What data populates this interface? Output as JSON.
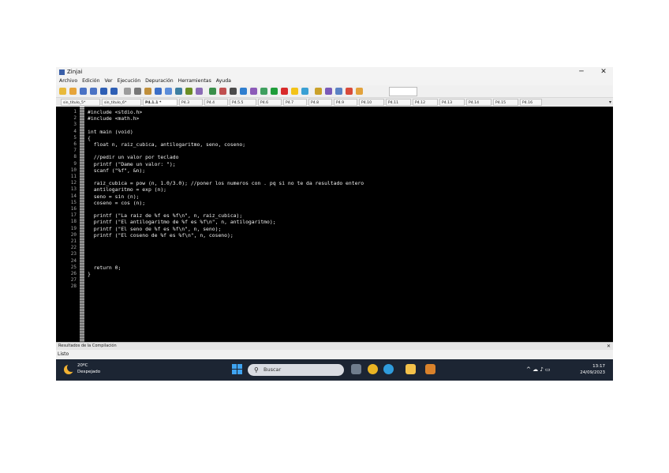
{
  "window": {
    "title": "Zinjai",
    "minimize": "─",
    "close": "✕"
  },
  "menu": [
    "Archivo",
    "Edición",
    "Ver",
    "Ejecución",
    "Depuración",
    "Herramientas",
    "Ayuda"
  ],
  "toolbar": {
    "icons": [
      "new-file-icon",
      "open-folder-icon",
      "save-icon",
      "save-all-icon",
      "undo-icon",
      "redo-icon",
      "cut-icon",
      "copy-icon",
      "paste-icon",
      "find-icon",
      "find-replace-icon",
      "goto-icon",
      "toggle-comment-icon",
      "indent-icon",
      "compile-icon",
      "build-icon",
      "settings-icon",
      "help-icon",
      "info-icon",
      "debug-icon",
      "run-icon",
      "stop-icon",
      "breakpoint-icon",
      "watch-icon",
      "inspect-icon",
      "step-icon",
      "project-icon",
      "flag-icon",
      "bug-icon"
    ],
    "colors": [
      "#e8b93b",
      "#e6a43a",
      "#4a72c4",
      "#4a72c4",
      "#2e5fb5",
      "#2e5fb5",
      "#9c9c9c",
      "#777777",
      "#c08f3b",
      "#3c6fc7",
      "#5c8dd9",
      "#3d7ea0",
      "#6b8e23",
      "#8a6bb5",
      "#3a8f4a",
      "#c05050",
      "#4b4b4b",
      "#2f7ecf",
      "#8c5ab8",
      "#3f9f5f",
      "#1f9d3a",
      "#d82a2a",
      "#f3c318",
      "#3aa0d4",
      "#caa12a",
      "#7a5ab8",
      "#5a82c4",
      "#d84a3a",
      "#e2a23c"
    ]
  },
  "tabs": [
    {
      "label": "sin_titulo_5*"
    },
    {
      "label": "sin_titulo_6*"
    },
    {
      "label": "P4.1.1 *"
    },
    {
      "label": "P4.3"
    },
    {
      "label": "P4.4"
    },
    {
      "label": "P4.5.5"
    },
    {
      "label": "P4.6"
    },
    {
      "label": "P4.7"
    },
    {
      "label": "P4.8"
    },
    {
      "label": "P4.9"
    },
    {
      "label": "P4.10"
    },
    {
      "label": "P4.11"
    },
    {
      "label": "P4.12"
    },
    {
      "label": "P4.13"
    },
    {
      "label": "P4.14"
    },
    {
      "label": "P4.15"
    },
    {
      "label": "P4.16"
    }
  ],
  "tabs_more": "▾",
  "editor": {
    "line_numbers": [
      "1",
      "2",
      "3",
      "4",
      "5",
      "6",
      "7",
      "8",
      "9",
      "10",
      "11",
      "12",
      "13",
      "14",
      "15",
      "16",
      "17",
      "18",
      "19",
      "20",
      "21",
      "22",
      "23",
      "24",
      "25",
      "26",
      "27",
      "28"
    ],
    "lines": [
      "#include <stdio.h>",
      "#include <math.h>",
      "",
      "int main (void)",
      "{",
      "  float n, raiz_cubica, antilogaritmo, seno, coseno;",
      "",
      "  //pedir un valor por teclado",
      "  printf (\"Dame un valor: \");",
      "  scanf (\"%f\", &n);",
      "",
      "  raiz_cubica = pow (n, 1.0/3.0); //poner los numeros con . pq si no te da resultado entero",
      "  antilogaritmo = exp (n);",
      "  seno = sin (n);",
      "  coseno = cos (n);",
      "",
      "  printf (\"La raiz de %f es %f\\n\", n, raiz_cubica);",
      "  printf (\"El antilogaritmo de %f es %f\\n\", n, antilogaritmo);",
      "  printf (\"El seno de %f es %f\\n\", n, seno);",
      "  printf (\"El coseno de %f es %f\\n\", n, coseno);",
      "",
      "",
      "",
      "",
      "  return 0;",
      "}",
      "",
      ""
    ]
  },
  "messages_bar": {
    "label": "Resultados de la Compilación",
    "close": "✕"
  },
  "status_bar": {
    "text": "Listo"
  },
  "taskbar": {
    "weather_temp": "20ºC",
    "weather_desc": "Despejado",
    "search_icon": "⚲",
    "search_placeholder": "Buscar",
    "apps": [
      "file-explorer-icon",
      "chrome-icon",
      "edge-icon",
      "folder-icon",
      "zinjai-icon"
    ],
    "app_colors": [
      "#6f7d8d",
      "#e9b423",
      "#2f9cdc",
      "#f3c14a",
      "#d9822b"
    ],
    "tray": "^  ☁  ♪  ▭",
    "time": "13:17",
    "date": "24/09/2023"
  }
}
